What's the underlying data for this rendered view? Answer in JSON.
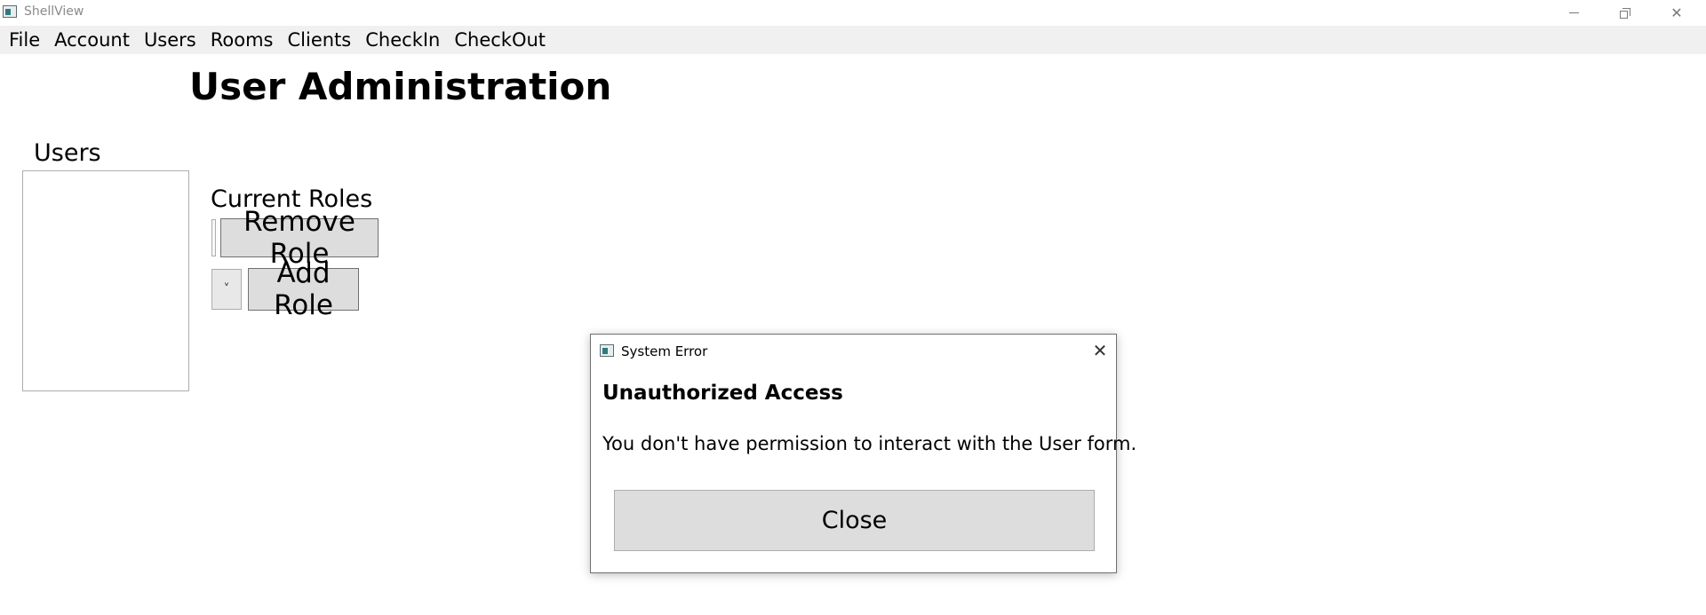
{
  "window": {
    "title": "ShellView"
  },
  "menu": {
    "items": [
      "File",
      "Account",
      "Users",
      "Rooms",
      "Clients",
      "CheckIn",
      "CheckOut"
    ]
  },
  "main": {
    "page_title": "User Administration",
    "users_label": "Users",
    "current_roles_label": "Current Roles",
    "remove_role_label": "Remove Role",
    "add_role_label": "Add Role",
    "combo_arrow": "˅"
  },
  "dialog": {
    "title": "System Error",
    "close_glyph": "✕",
    "heading": "Unauthorized Access",
    "message": "You don't have permission to interact with the User form.",
    "button_label": "Close"
  }
}
